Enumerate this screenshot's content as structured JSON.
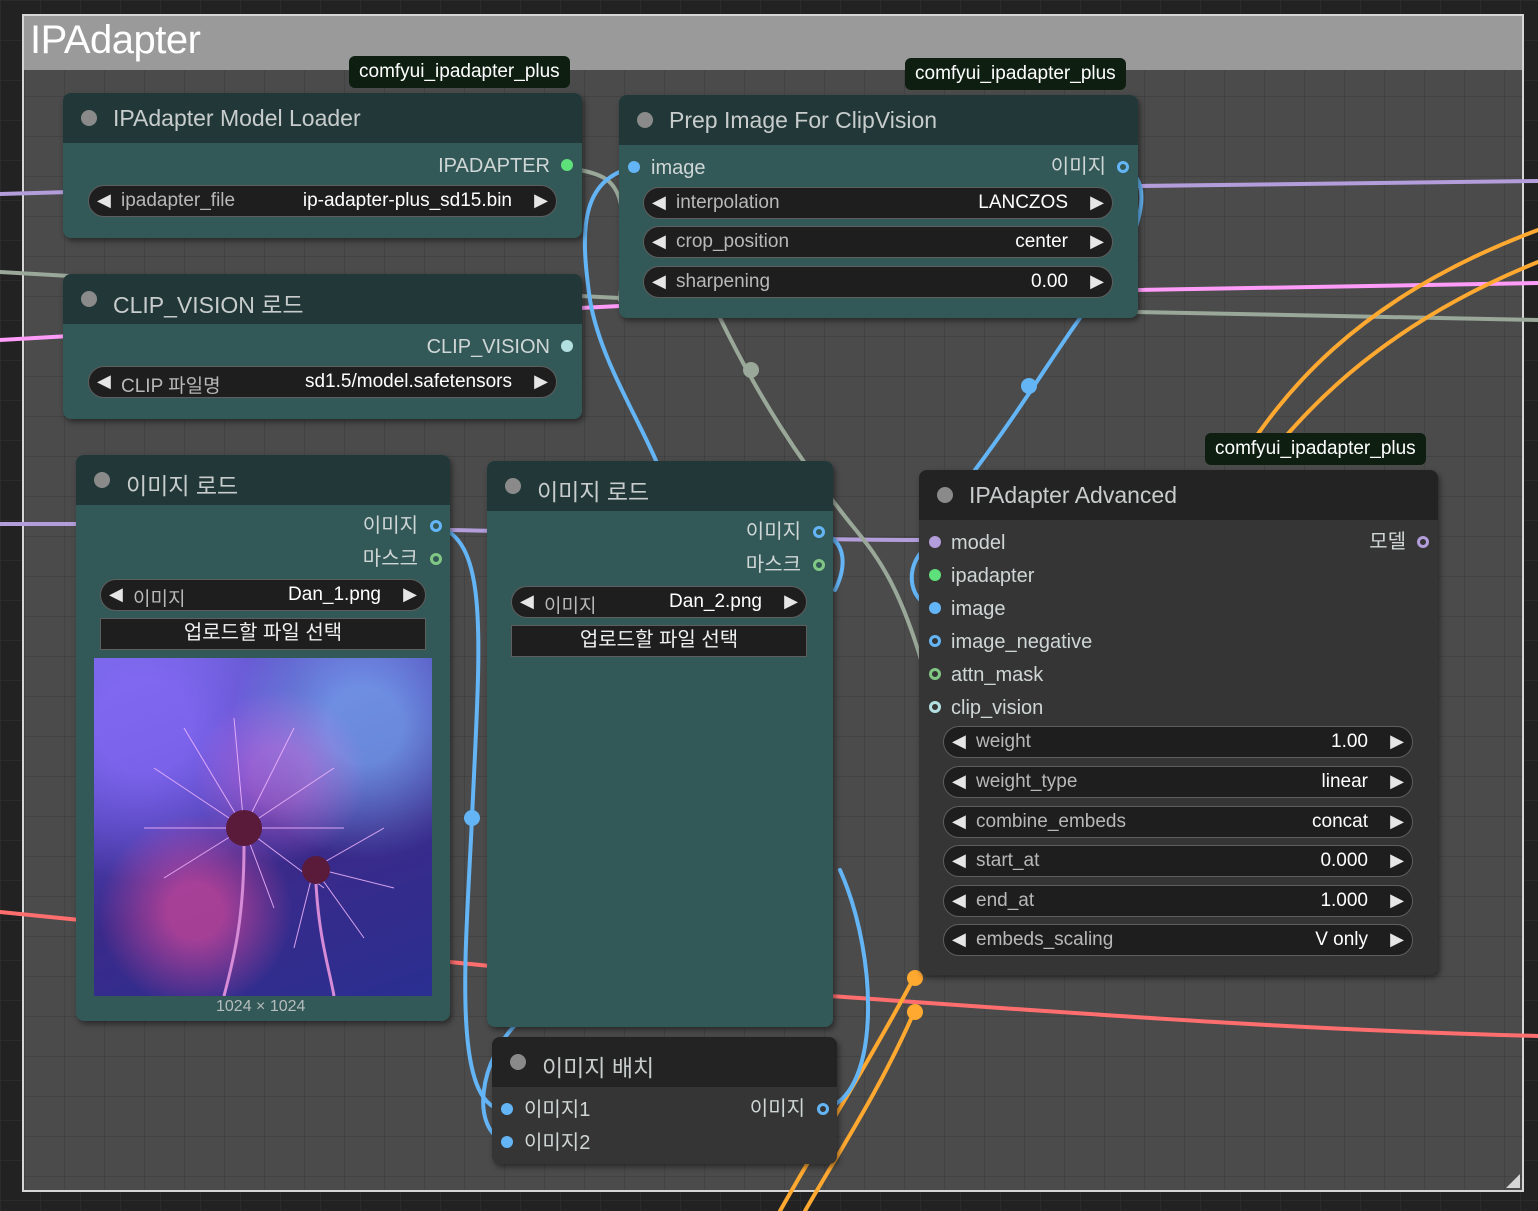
{
  "group": {
    "title": "IPAdapter"
  },
  "colors": {
    "ipadapter": "#5ee07a",
    "image": "#64b5f6",
    "clip_vision": "#b2e0e0",
    "model": "#b39ddb",
    "mask": "#81c784",
    "latent": "#ff9cf9",
    "vae": "#ff6e6e",
    "conditioning": "#ffa931",
    "link_gray": "#9aa89a"
  },
  "badges": {
    "model_loader": "comfyui_ipadapter_plus",
    "prep_image": "comfyui_ipadapter_plus",
    "advanced": "comfyui_ipadapter_plus"
  },
  "model_loader": {
    "title": "IPAdapter Model Loader",
    "output": "IPADAPTER",
    "widget": {
      "name": "ipadapter_file",
      "value": "ip-adapter-plus_sd15.bin"
    }
  },
  "clip_loader": {
    "title": "CLIP_VISION 로드",
    "output": "CLIP_VISION",
    "widget": {
      "name": "CLIP 파일명",
      "value": "sd1.5/model.safetensors"
    }
  },
  "prep_image": {
    "title": "Prep Image For ClipVision",
    "input": "image",
    "output": "이미지",
    "widgets": [
      {
        "name": "interpolation",
        "value": "LANCZOS"
      },
      {
        "name": "crop_position",
        "value": "center"
      },
      {
        "name": "sharpening",
        "value": "0.00"
      }
    ]
  },
  "load_image_1": {
    "title": "이미지 로드",
    "outputs": [
      "이미지",
      "마스크"
    ],
    "widget": {
      "name": "이미지",
      "value": "Dan_1.png"
    },
    "upload": "업로드할 파일 선택",
    "preview_size": "1024 × 1024"
  },
  "load_image_2": {
    "title": "이미지 로드",
    "outputs": [
      "이미지",
      "마스크"
    ],
    "widget": {
      "name": "이미지",
      "value": "Dan_2.png"
    },
    "upload": "업로드할 파일 선택"
  },
  "batch": {
    "title": "이미지 배치",
    "inputs": [
      "이미지1",
      "이미지2"
    ],
    "output": "이미지"
  },
  "advanced": {
    "title": "IPAdapter Advanced",
    "inputs": [
      "model",
      "ipadapter",
      "image",
      "image_negative",
      "attn_mask",
      "clip_vision"
    ],
    "output": "모델",
    "widgets": [
      {
        "name": "weight",
        "value": "1.00"
      },
      {
        "name": "weight_type",
        "value": "linear"
      },
      {
        "name": "combine_embeds",
        "value": "concat"
      },
      {
        "name": "start_at",
        "value": "0.000"
      },
      {
        "name": "end_at",
        "value": "1.000"
      },
      {
        "name": "embeds_scaling",
        "value": "V only"
      }
    ]
  },
  "icons": {
    "left_arrow": "◀",
    "right_arrow": "▶"
  }
}
